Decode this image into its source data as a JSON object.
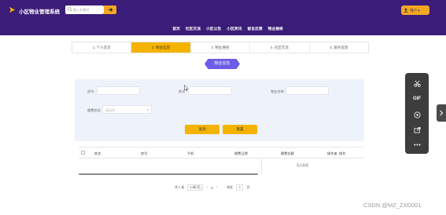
{
  "header": {
    "app_title": "小区物业管理系统",
    "search_placeholder": "输入关键词",
    "search_button_icon": "arrow-right-icon",
    "user_label": "用户 ▾"
  },
  "nav": {
    "items": [
      "首页",
      "社区交流",
      "小区公告",
      "小区资讯",
      "留言反馈",
      "物业报修"
    ]
  },
  "steps": [
    {
      "label": "1. 个人首页",
      "active": false
    },
    {
      "label": "2. 物业信息",
      "active": true
    },
    {
      "label": "3. 物业维修",
      "active": false
    },
    {
      "label": "4. 社区交流",
      "active": false
    },
    {
      "label": "5. 服务反馈",
      "active": false
    }
  ],
  "section_title": "物业信息",
  "filters": {
    "field1_label": "房号",
    "field2_label": "姓名",
    "field3_label": "物业名称",
    "status_label": "缴费状态",
    "status_placeholder": "请选择",
    "query_button": "查询",
    "reset_button": "重置"
  },
  "table": {
    "columns": [
      "姓名",
      "房号",
      "手机",
      "缴费日期",
      "缴费金额",
      "操作者",
      "操作"
    ],
    "empty_text": "暂无数据"
  },
  "pagination": {
    "total_text": "共 0 条",
    "page_size": "10条/页",
    "current_page": "1",
    "goto_label": "前往",
    "goto_value": "1",
    "page_suffix": "页"
  },
  "toolbar": {
    "gif_label": "GIF"
  },
  "watermark": "CSDN @MZ_ZXD001",
  "colors": {
    "header_bg": "#3b1c78",
    "accent": "#f5b301",
    "section_title_bg": "#6c5ce7",
    "panel_bg": "#eef2fb"
  }
}
